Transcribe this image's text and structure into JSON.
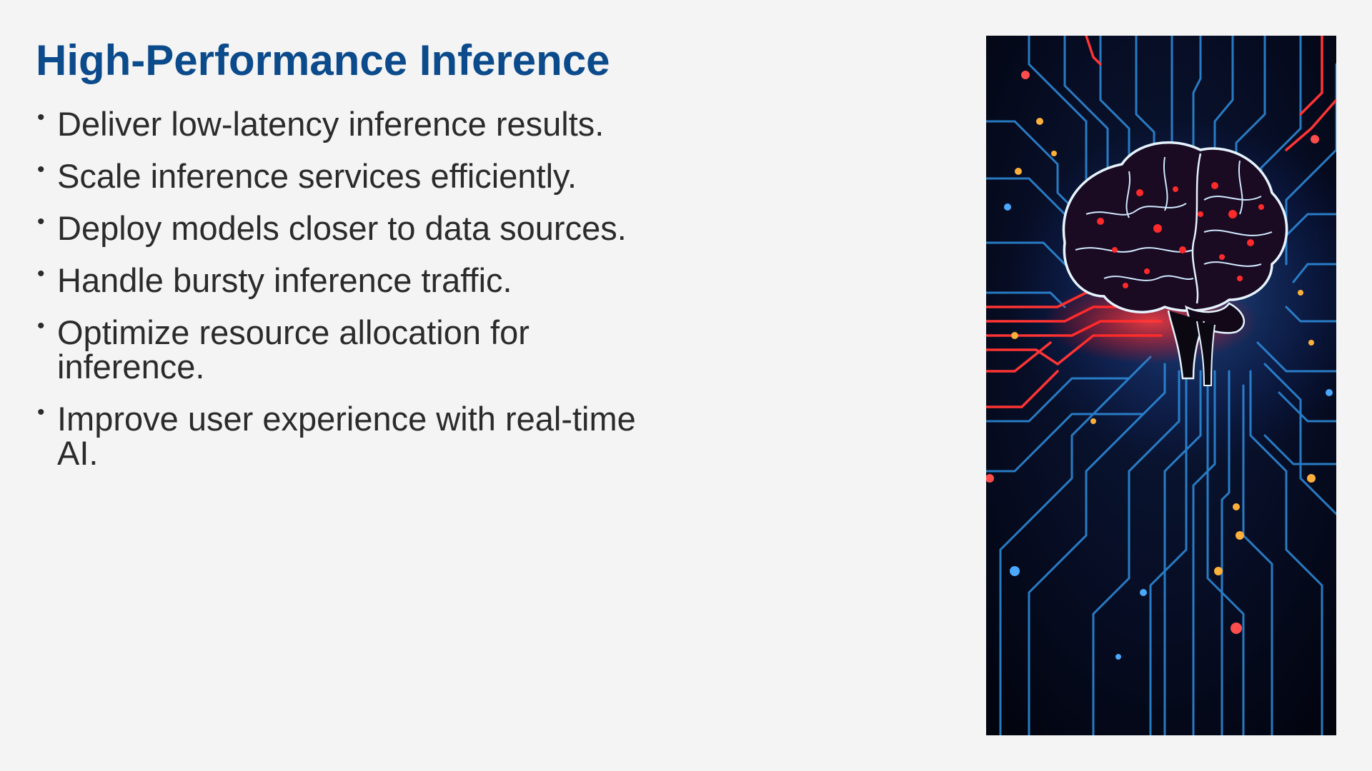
{
  "slide": {
    "title": "High-Performance Inference",
    "bullets": [
      "Deliver low-latency inference results.",
      "Scale inference services efficiently.",
      "Deploy models closer to data sources.",
      "Handle bursty inference traffic.",
      "Optimize resource allocation for inference.",
      "Improve user experience with real-time AI."
    ],
    "bullet_glyph": "•"
  },
  "image": {
    "depicts": "glowing-brain-circuit-illustration",
    "colors": {
      "background": "#04081a",
      "circuit_blue": "#2e8fe0",
      "circuit_red": "#ff3434",
      "node_orange": "#ffb03a",
      "brain_outline": "#e6f4ff",
      "brain_glow": "#ff2a2a"
    }
  }
}
